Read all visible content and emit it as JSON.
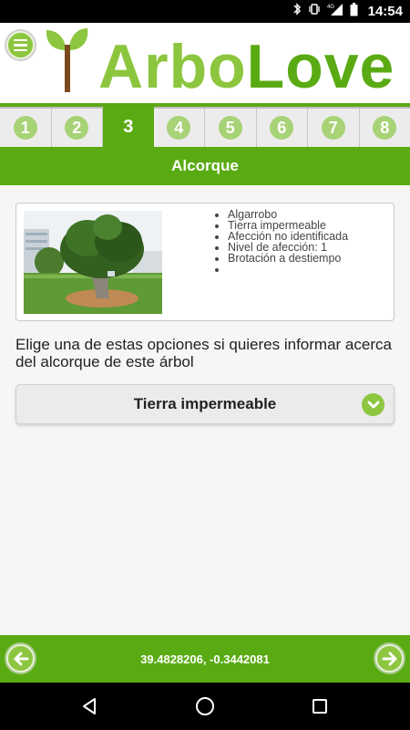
{
  "status_bar": {
    "time": "14:54",
    "network": "4G"
  },
  "header": {
    "logo_part1": "Arbo",
    "logo_part2": "Love",
    "menu_icon": "hamburger-menu-icon"
  },
  "steps": [
    {
      "label": "1",
      "active": false
    },
    {
      "label": "2",
      "active": false
    },
    {
      "label": "3",
      "active": true
    },
    {
      "label": "4",
      "active": false
    },
    {
      "label": "5",
      "active": false
    },
    {
      "label": "6",
      "active": false
    },
    {
      "label": "7",
      "active": false
    },
    {
      "label": "8",
      "active": false
    }
  ],
  "section_title": "Alcorque",
  "tree": {
    "details": [
      "Algarrobo",
      "Tierra impermeable",
      "Afección no identificada",
      "Nivel de afección: 1",
      "Brotación a destiempo",
      ""
    ]
  },
  "instructions": "Elige una de estas opciones si quieres informar acerca del alcorque de este árbol",
  "select": {
    "value": "Tierra impermeable"
  },
  "footer": {
    "coordinates": "39.4828206, -0.3442081"
  },
  "colors": {
    "brand_green": "#5aab13",
    "light_green": "#8dc63f",
    "logo_light": "#8cc63e"
  }
}
